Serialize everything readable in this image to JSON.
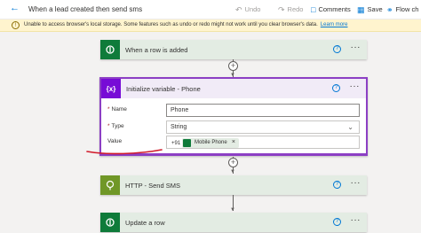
{
  "topbar": {
    "title": "When a lead created then send sms",
    "undo": "Undo",
    "redo": "Redo",
    "comments": "Comments",
    "save": "Save",
    "flow_checker": "Flow ch"
  },
  "warning": {
    "text": "Unable to access browser's local storage. Some features such as undo or redo might not work until you clear browser's data.",
    "link": "Learn more"
  },
  "steps": {
    "trigger": {
      "title": "When a row is added"
    },
    "init_var": {
      "title": "Initialize variable - Phone",
      "icon_text": "{x}",
      "fields": {
        "name_label": "Name",
        "name_value": "Phone",
        "type_label": "Type",
        "type_value": "String",
        "value_label": "Value",
        "value_prefix": "+91",
        "token_label": "Mobile Phone",
        "token_remove": "×"
      }
    },
    "http": {
      "title": "HTTP - Send SMS"
    },
    "update": {
      "title": "Update a row"
    }
  },
  "common": {
    "help": "?",
    "more": "···",
    "plus": "+",
    "req": "*"
  },
  "colors": {
    "accent": "#0078d4",
    "dataverse_green": "#0f7b3a",
    "variable_purple": "#770bd6",
    "http_green": "#709727",
    "annotation_red": "#d11a2a"
  }
}
